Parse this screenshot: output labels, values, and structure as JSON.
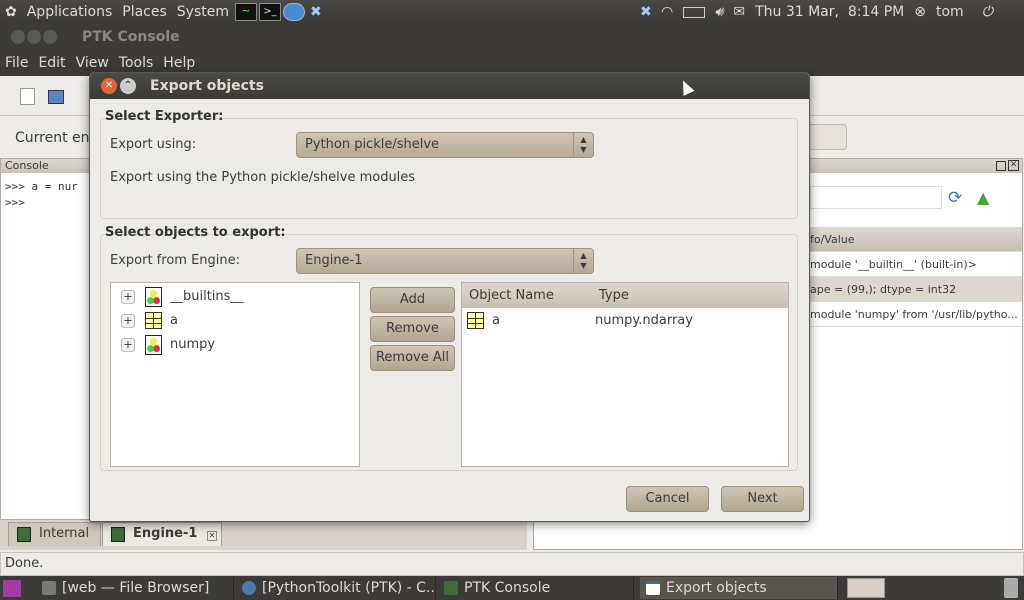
{
  "top_panel": {
    "menus": [
      "Applications",
      "Places",
      "System"
    ],
    "clock": "Thu 31 Mar,  8:14 PM",
    "user": "tom"
  },
  "window": {
    "title": "PTK Console",
    "menu": [
      "File",
      "Edit",
      "View",
      "Tools",
      "Help"
    ],
    "engine_label": "Current eng"
  },
  "console": {
    "title": "Console",
    "lines": ">>> a = nur\n>>>"
  },
  "right_pane": {
    "column": "fo/Value",
    "rows": [
      "module '__builtin__' (built-in)>",
      "ape = (99,); dtype = int32",
      "module 'numpy' from '/usr/lib/pytho..."
    ]
  },
  "tabs": [
    {
      "label": "Internal"
    },
    {
      "label": "Engine-1"
    }
  ],
  "status": "Done.",
  "taskbar": {
    "items": [
      "[web — File Browser]",
      "[PythonToolkit (PTK) - C...",
      "PTK Console",
      "Export objects"
    ]
  },
  "dialog": {
    "title": "Export objects",
    "exporter_section": "Select Exporter:",
    "export_using_label": "Export using:",
    "export_using_value": "Python pickle/shelve",
    "description": "Export using the Python pickle/shelve modules",
    "objects_section": "Select objects to export:",
    "engine_label": "Export from Engine:",
    "engine_value": "Engine-1",
    "tree": [
      {
        "name": "__builtins__",
        "icon": "module-icon"
      },
      {
        "name": "a",
        "icon": "array-icon"
      },
      {
        "name": "numpy",
        "icon": "module-icon"
      }
    ],
    "add": "Add",
    "remove": "Remove",
    "remove_all": "Remove All",
    "table": {
      "headers": [
        "Object Name",
        "Type"
      ],
      "rows": [
        {
          "name": "a",
          "type": "numpy.ndarray"
        }
      ]
    },
    "cancel": "Cancel",
    "next": "Next"
  }
}
